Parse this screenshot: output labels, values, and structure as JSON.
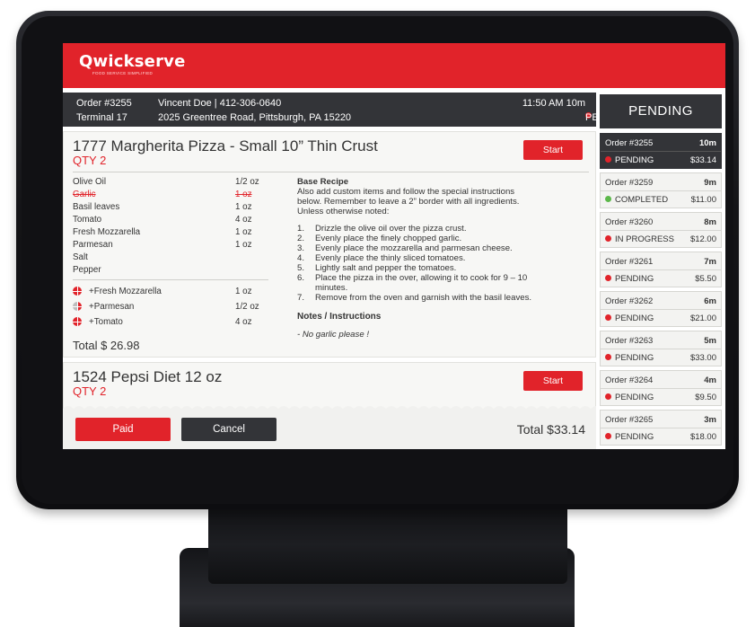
{
  "brand": {
    "name": "Qwickserve",
    "tagline": "FOOD SERVICE SIMPLIFIED",
    "accent": "#e1232a",
    "dark": "#333438"
  },
  "order": {
    "number": "Order #3255",
    "terminal": "Terminal 17",
    "customer": "Vincent Doe  |  412-306-0640",
    "address": "2025 Greentree Road, Pittsburgh, PA  15220",
    "time": "11:50 AM  10m",
    "status": "PENDING"
  },
  "status_header": "PENDING",
  "item1": {
    "title": "1777 Margherita Pizza  - Small 10” Thin Crust",
    "qty": "QTY 2",
    "start_label": "Start",
    "ingredients": [
      {
        "name": "Olive Oil",
        "amount": "1/2 oz",
        "removed": false
      },
      {
        "name": "Garlic",
        "amount": "1 oz",
        "removed": true
      },
      {
        "name": "Basil leaves",
        "amount": "1 oz",
        "removed": false
      },
      {
        "name": "Tomato",
        "amount": "4 oz",
        "removed": false
      },
      {
        "name": "Fresh Mozzarella",
        "amount": "1 oz",
        "removed": false
      },
      {
        "name": "Parmesan",
        "amount": "1 oz",
        "removed": false
      },
      {
        "name": "Salt",
        "amount": "",
        "removed": false
      },
      {
        "name": "Pepper",
        "amount": "",
        "removed": false
      }
    ],
    "extras": [
      {
        "name": "+Fresh Mozzarella",
        "amount": "1 oz",
        "portion": "whole"
      },
      {
        "name": "+Parmesan",
        "amount": "1/2 oz",
        "portion": "half"
      },
      {
        "name": "+Tomato",
        "amount": "4 oz",
        "portion": "whole"
      }
    ],
    "total": "Total $ 26.98",
    "recipe_title": "Base Recipe",
    "recipe_intro": [
      "Also add custom items and follow the special instructions",
      "below. Remember to leave a 2” border with all ingredients.",
      "Unless otherwise noted:"
    ],
    "steps": [
      {
        "n": "1.",
        "text": "Drizzle the olive oil over the pizza crust."
      },
      {
        "n": "2.",
        "text": "Evenly place the finely chopped garlic."
      },
      {
        "n": "3.",
        "text": "Evenly place the  mozzarella and parmesan cheese."
      },
      {
        "n": "4.",
        "text": "Evenly place the thinly sliced tomatoes."
      },
      {
        "n": "5.",
        "text": "Lightly salt and pepper the tomatoes."
      },
      {
        "n": "6.",
        "text": "Place the pizza in the over, allowing it to cook for 9 – 10"
      },
      {
        "n": "",
        "text": "minutes."
      },
      {
        "n": "7.",
        "text": "Remove from the oven and garnish with the basil leaves."
      }
    ],
    "notes_title": "Notes / Instructions",
    "notes": "- No garlic please !"
  },
  "item2": {
    "title": "1524 Pepsi Diet 12 oz",
    "qty": "QTY 2",
    "start_label": "Start"
  },
  "footer": {
    "paid_label": "Paid",
    "cancel_label": "Cancel",
    "total": "Total  $33.14"
  },
  "orders": [
    {
      "number": "Order #3255",
      "mins": "10m",
      "status": "PENDING",
      "amount": "$33.14",
      "color": "#e1232a",
      "active": true
    },
    {
      "number": "Order #3259",
      "mins": "9m",
      "status": "COMPLETED",
      "amount": "$11.00",
      "color": "#5cb84a",
      "active": false
    },
    {
      "number": "Order #3260",
      "mins": "8m",
      "status": "IN PROGRESS",
      "amount": "$12.00",
      "color": "#e1232a",
      "active": false
    },
    {
      "number": "Order #3261",
      "mins": "7m",
      "status": "PENDING",
      "amount": "$5.50",
      "color": "#e1232a",
      "active": false
    },
    {
      "number": "Order #3262",
      "mins": "6m",
      "status": "PENDING",
      "amount": "$21.00",
      "color": "#e1232a",
      "active": false
    },
    {
      "number": "Order #3263",
      "mins": "5m",
      "status": "PENDING",
      "amount": "$33.00",
      "color": "#e1232a",
      "active": false
    },
    {
      "number": "Order #3264",
      "mins": "4m",
      "status": "PENDING",
      "amount": "$9.50",
      "color": "#e1232a",
      "active": false
    },
    {
      "number": "Order #3265",
      "mins": "3m",
      "status": "PENDING",
      "amount": "$18.00",
      "color": "#e1232a",
      "active": false
    }
  ]
}
